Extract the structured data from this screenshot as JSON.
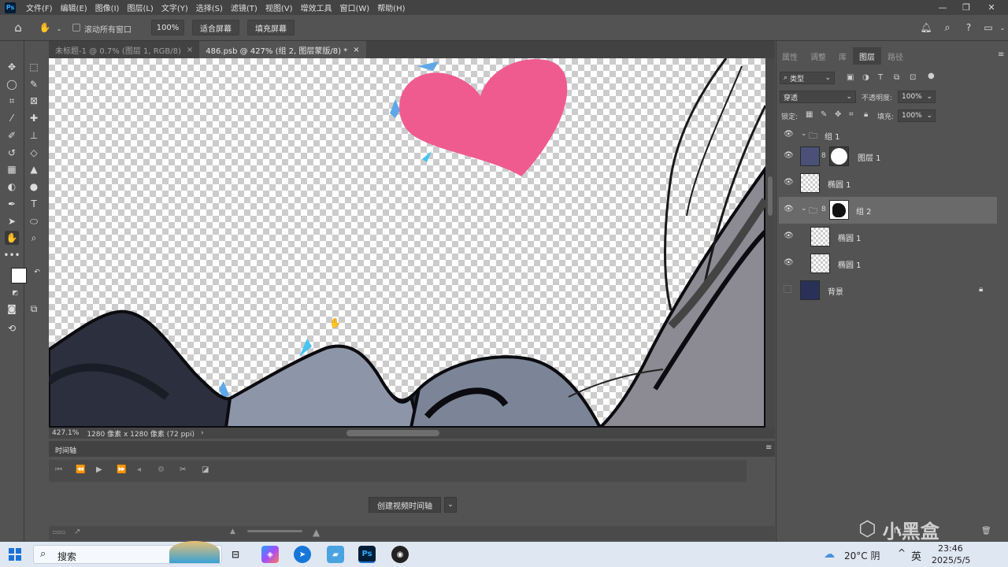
{
  "menubar": {
    "logo": "Ps",
    "items": [
      "文件(F)",
      "编辑(E)",
      "图像(I)",
      "图层(L)",
      "文字(Y)",
      "选择(S)",
      "滤镜(T)",
      "视图(V)",
      "增效工具",
      "窗口(W)",
      "帮助(H)"
    ]
  },
  "options": {
    "scroll_all_label": "滚动所有窗口",
    "zoom_value": "100%",
    "fit_screen": "适合屏幕",
    "fill_screen": "填充屏幕"
  },
  "tabs": [
    {
      "label": "未标题-1 @ 0.7% (图层 1, RGB/8)"
    },
    {
      "label": "486.psb @ 427% (组 2, 图层蒙版/8) *"
    }
  ],
  "status": {
    "zoom": "427.1%",
    "doc_info": "1280 像素 x 1280 像素 (72 ppi)"
  },
  "timeline": {
    "title": "时间轴",
    "create_button": "创建视频时间轴"
  },
  "panel": {
    "tabs": [
      "属性",
      "调整",
      "库",
      "图层",
      "路径"
    ],
    "active_tab": "图层",
    "filter_kind": "类型",
    "blend_mode": "穿透",
    "opacity_label": "不透明度:",
    "opacity_value": "100%",
    "lock_label": "锁定:",
    "fill_label": "填充:",
    "fill_value": "100%"
  },
  "layers": [
    {
      "name": "组 1",
      "type": "group"
    },
    {
      "name": "图层 1",
      "type": "layer-mask"
    },
    {
      "name": "椭圆 1",
      "type": "shape"
    },
    {
      "name": "组 2",
      "type": "group-mask",
      "selected": true
    },
    {
      "name": "椭圆 1",
      "type": "shape"
    },
    {
      "name": "椭圆 1",
      "type": "shape"
    },
    {
      "name": "背景",
      "type": "background",
      "locked": true
    }
  ],
  "taskbar": {
    "search_placeholder": "搜索",
    "weather": "20°C 阴",
    "ime": "英",
    "time": "23:46",
    "date": "2025/5/5"
  },
  "watermark": "小黑盒",
  "colors": {
    "heart": "#ef5b8f",
    "accent_blue": "#31a8ff"
  }
}
